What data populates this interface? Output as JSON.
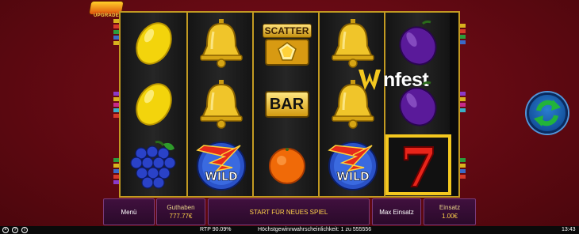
{
  "game": {
    "logo_text": "UPGRADE",
    "scatter_label": "SCATTER",
    "bar_label": "BAR",
    "wild_label": "WILD",
    "seven_label": "7",
    "watermark_text": "nfest"
  },
  "reels": [
    [
      "lemon",
      "lemon",
      "grapes"
    ],
    [
      "bell",
      "bell",
      "wild"
    ],
    [
      "scatter",
      "bar",
      "orange"
    ],
    [
      "bell",
      "bell",
      "wild"
    ],
    [
      "plum",
      "plum",
      "seven"
    ]
  ],
  "controls": {
    "menu_label": "Menü",
    "balance_label": "Guthaben",
    "balance_value": "777.77€",
    "spin_label": "START FÜR NEUES SPIEL",
    "max_bet_label": "Max Einsatz",
    "bet_label": "Einsatz",
    "bet_value": "1.00€"
  },
  "status_bar": {
    "rtp": "RTP 90.09%",
    "max_win_probability": "Höchstgewinnwahrscheinlichkeit: 1 zu 555556",
    "time": "13:43"
  },
  "icons": {
    "refresh": "refresh-arrows-icon",
    "close": "close-icon",
    "info": "info-icon"
  },
  "colors": {
    "background": "#6a0a14",
    "reel_frame": "#c29a22",
    "refresh_green": "#22b33a",
    "control_text": "#ffd34a"
  }
}
